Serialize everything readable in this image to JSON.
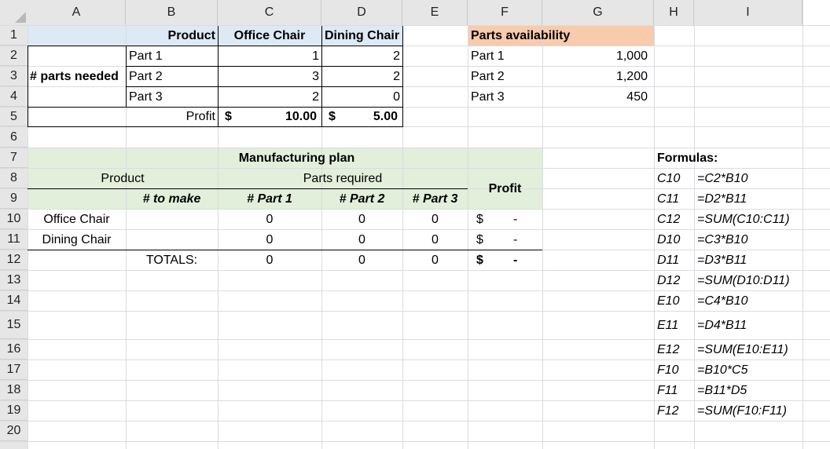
{
  "columns": [
    "A",
    "B",
    "C",
    "D",
    "E",
    "F",
    "G",
    "H",
    "I"
  ],
  "rows": [
    "1",
    "2",
    "3",
    "4",
    "5",
    "6",
    "7",
    "8",
    "9",
    "10",
    "11",
    "12",
    "13",
    "14",
    "15",
    "16",
    "17",
    "18",
    "19",
    "20"
  ],
  "colors": {
    "header_blue": "#dde9f5",
    "header_orange": "#f8cbad",
    "plan_green": "#e2efda",
    "gridline": "#dadce0",
    "header_bg": "#e6e6e6"
  },
  "table1": {
    "product_label": "Product",
    "col_office": "Office Chair",
    "col_dining": "Dining Chair",
    "parts_needed_label": "# parts needed",
    "part1": "Part 1",
    "part2": "Part 2",
    "part3": "Part 3",
    "c2": "1",
    "d2": "2",
    "c3": "3",
    "d3": "2",
    "c4": "2",
    "d4": "0",
    "profit_label": "Profit",
    "c5_sym": "$",
    "c5_val": "10.00",
    "d5_sym": "$",
    "d5_val": "5.00"
  },
  "availability": {
    "title": "Parts availability",
    "part1": "Part 1",
    "part2": "Part 2",
    "part3": "Part 3",
    "g2": "1,000",
    "g3": "1,200",
    "g4": "450"
  },
  "plan": {
    "title": "Manufacturing plan",
    "product_label": "Product",
    "parts_required": "Parts required",
    "profit": "Profit",
    "to_make": "# to make",
    "part1": "# Part 1",
    "part2": "# Part 2",
    "part3": "# Part 3",
    "row10_label": "Office Chair",
    "row11_label": "Dining Chair",
    "totals_label": "TOTALS:",
    "c10": "0",
    "d10": "0",
    "e10": "0",
    "f10_sym": "$",
    "f10_val": "-",
    "c11": "0",
    "d11": "0",
    "e11": "0",
    "f11_sym": "$",
    "f11_val": "-",
    "c12": "0",
    "d12": "0",
    "e12": "0",
    "f12_sym": "$",
    "f12_val": "-"
  },
  "formulas": {
    "title": "Formulas:",
    "items": [
      {
        "cell": "C10",
        "formula": "=C2*B10"
      },
      {
        "cell": "C11",
        "formula": "=D2*B11"
      },
      {
        "cell": "C12",
        "formula": "=SUM(C10:C11)"
      },
      {
        "cell": "D10",
        "formula": "=C3*B10"
      },
      {
        "cell": "D11",
        "formula": "=D3*B11"
      },
      {
        "cell": "D12",
        "formula": "=SUM(D10:D11)"
      },
      {
        "cell": "E10",
        "formula": "=C4*B10"
      },
      {
        "cell": "E11",
        "formula": "=D4*B11"
      },
      {
        "cell": "E12",
        "formula": "=SUM(E10:E11)"
      },
      {
        "cell": "F10",
        "formula": "=B10*C5"
      },
      {
        "cell": "F11",
        "formula": "=B11*D5"
      },
      {
        "cell": "F12",
        "formula": "=SUM(F10:F11)"
      }
    ]
  }
}
